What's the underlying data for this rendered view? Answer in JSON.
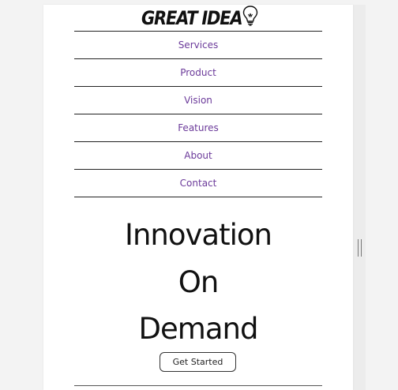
{
  "logo": {
    "text": "GREAT IDEA",
    "icon": "lightbulb-icon"
  },
  "nav": {
    "items": [
      {
        "label": "Services"
      },
      {
        "label": "Product"
      },
      {
        "label": "Vision"
      },
      {
        "label": "Features"
      },
      {
        "label": "About"
      },
      {
        "label": "Contact"
      }
    ]
  },
  "hero": {
    "line1": "Innovation",
    "line2": "On",
    "line3": "Demand",
    "cta_label": "Get Started"
  },
  "colors": {
    "nav_link": "#6b3a9a",
    "text": "#111111",
    "background": "#ffffff"
  }
}
